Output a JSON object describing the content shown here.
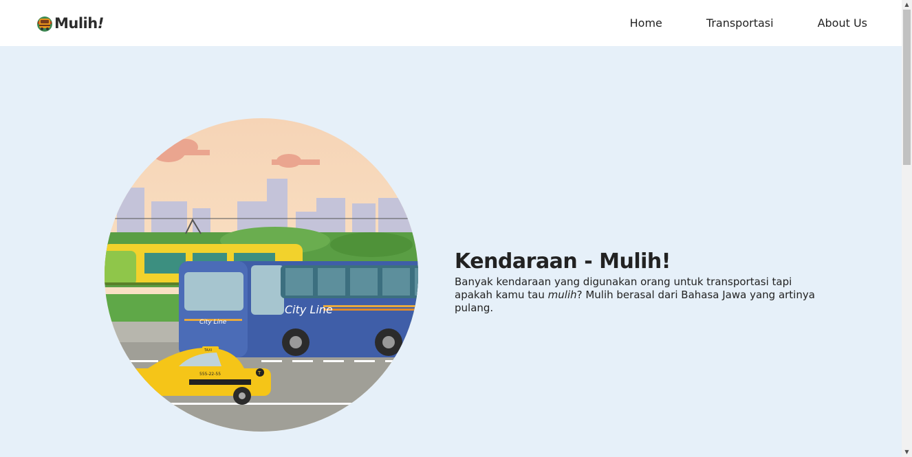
{
  "brand": {
    "name": "Mulih",
    "bang": "!"
  },
  "nav": {
    "items": [
      {
        "label": "Home"
      },
      {
        "label": "Transportasi"
      },
      {
        "label": "About Us"
      }
    ]
  },
  "hero": {
    "title": "Kendaraan - Mulih!",
    "desc_before": "Banyak kendaraan yang digunakan orang untuk transportasi tapi apakah kamu tau ",
    "desc_em": "mulih",
    "desc_after": "? Mulih berasal dari Bahasa Jawa yang artinya pulang.",
    "bus_text": "City Line",
    "bus_small_text": "City Line",
    "taxi_sign": "TAXI",
    "taxi_number": "555-22-55",
    "taxi_logo": "T"
  },
  "colors": {
    "background": "#e6f0f9",
    "navbar": "#ffffff",
    "bus": "#3f5ea8",
    "taxi": "#f5c518",
    "tram": "#f2d22c"
  },
  "scrollbar": {
    "up_icon": "▲",
    "down_icon": "▼"
  }
}
